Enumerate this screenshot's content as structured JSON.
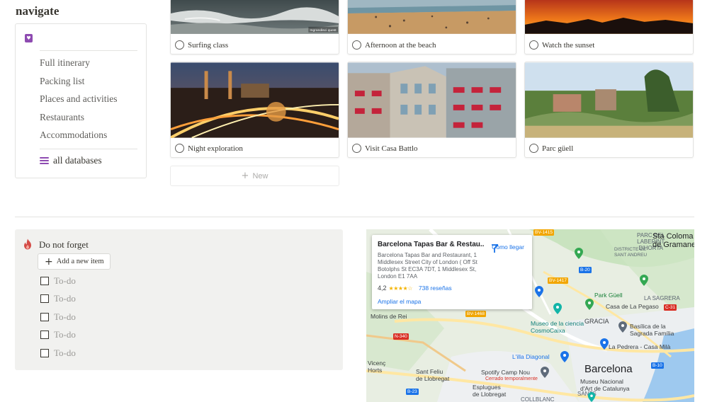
{
  "navigate": {
    "title": "navigate",
    "links": [
      "Full itinerary",
      "Packing list",
      "Places and activities",
      "Restaurants",
      "Accommodations"
    ],
    "all_databases": "all databases"
  },
  "gallery": {
    "cards": [
      {
        "label": "Surfing class",
        "image": "surfing-photo"
      },
      {
        "label": "Afternoon at the beach",
        "image": "beach-photo"
      },
      {
        "label": "Watch the sunset",
        "image": "sunset-photo"
      },
      {
        "label": "Night exploration",
        "image": "night-city-photo"
      },
      {
        "label": "Visit Casa Battlo",
        "image": "casa-batllo-photo"
      },
      {
        "label": "Parc güell",
        "image": "parc-guell-photo"
      }
    ],
    "photo_watermark": "Ingrandisci quest",
    "new_label": "New"
  },
  "forget": {
    "title": "Do not forget",
    "add_label": "Add a new item",
    "todos": [
      "To-do",
      "To-do",
      "To-do",
      "To-do",
      "To-do"
    ]
  },
  "map": {
    "place_name": "Barcelona Tapas Bar & Restau...",
    "address": "Barcelona Tapas Bar and Restaurant, 1 Middlesex Street City of London ( Off St Botolphs St EC3A 7DT, 1 Middlesex St, London E1 7AA",
    "rating": "4,2",
    "stars": "★★★★☆",
    "reviews": "738 reseñas",
    "enlarge": "Ampliar el mapa",
    "directions": "Cómo llegar",
    "city": "Barcelona",
    "labels": {
      "parc_del_laberint": "PARC DEL\nLABERINT\nD'HORTA",
      "sta_coloma": "Sta Coloma\nde Gramanet",
      "districte": "DISTRICTE DE\nSANT ANDREU",
      "parc_guell": "Park Güell",
      "casa_la_pegaso": "Casa de La Pegaso",
      "la_sagrera": "LA SAGRERA",
      "gracia": "GRACIA",
      "basilica": "Basílica de la\nSagrada Família",
      "cosmo": "Museo de la ciencia\nCosmoCaixa",
      "la_pedrera": "La Pedrera - Casa Milà",
      "molins": "Molins de Rei",
      "illa": "L'illa Diagonal",
      "spotify": "Spotify Camp Nou",
      "spotify_sub": "Cerrado temporalmente",
      "sant_feliu": "Sant Feliu\nde Llobregat",
      "esplugues": "Esplugues\nde Llobregat",
      "museu": "Museu Nacional\nd'Art de Catalunya",
      "sants": "SANTS",
      "collblanc": "COLLBLANC",
      "vicenc": "Vicenç\nHorts"
    },
    "roads": [
      "BV-1415",
      "B-20",
      "BV-1417",
      "C-31",
      "BV-1468",
      "N-340",
      "B-10",
      "B-23"
    ]
  },
  "colors": {
    "accent_purple": "#8e4bb1",
    "flame_red": "#d44c47",
    "callout_bg": "#f1f1ef",
    "link_blue": "#1a73e8"
  }
}
